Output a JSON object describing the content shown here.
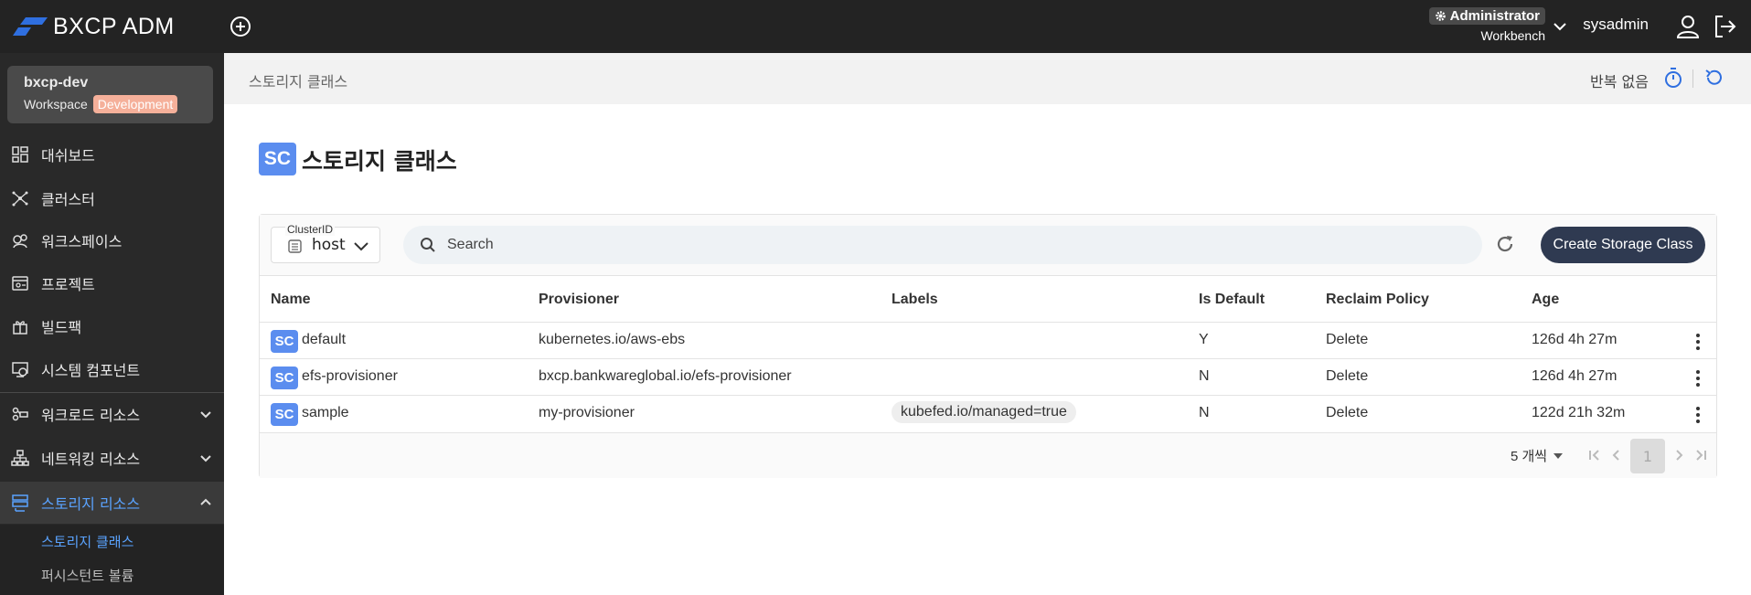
{
  "topbar": {
    "app_name": "BXCP ADMIN",
    "role": "Administrator",
    "role_sub": "Workbench",
    "username": "sysadmin"
  },
  "workspace": {
    "name": "bxcp-dev",
    "type": "Workspace",
    "badge": "Development"
  },
  "sidebar": {
    "items": [
      {
        "label": "대쉬보드",
        "icon": "dashboard-icon"
      },
      {
        "label": "클러스터",
        "icon": "cluster-icon"
      },
      {
        "label": "워크스페이스",
        "icon": "workspace-icon"
      },
      {
        "label": "프로젝트",
        "icon": "project-icon"
      },
      {
        "label": "빌드팩",
        "icon": "buildpack-icon"
      },
      {
        "label": "시스템 컴포넌트",
        "icon": "system-component-icon"
      },
      {
        "label": "워크로드 리소스",
        "icon": "workload-icon"
      },
      {
        "label": "네트워킹 리소스",
        "icon": "network-icon"
      },
      {
        "label": "스토리지 리소스",
        "icon": "storage-icon"
      }
    ],
    "sub_items": [
      "스토리지 클래스",
      "퍼시스턴트 볼륨"
    ]
  },
  "header": {
    "breadcrumb": "스토리지 클래스",
    "repeat": "반복 없음"
  },
  "page": {
    "badge": "SC",
    "title": "스토리지 클래스"
  },
  "toolbar": {
    "cluster_label": "ClusterID",
    "cluster_value": "host",
    "search_placeholder": "Search",
    "create_label": "Create Storage Class"
  },
  "table": {
    "headers": [
      "Name",
      "Provisioner",
      "Labels",
      "Is Default",
      "Reclaim Policy",
      "Age"
    ],
    "badge": "SC",
    "rows": [
      {
        "name": "default",
        "provisioner": "kubernetes.io/aws-ebs",
        "label": "",
        "is_default": "Y",
        "reclaim": "Delete",
        "age": "126d 4h 27m"
      },
      {
        "name": "efs-provisioner",
        "provisioner": "bxcp.bankwareglobal.io/efs-provisioner",
        "label": "",
        "is_default": "N",
        "reclaim": "Delete",
        "age": "126d 4h 27m"
      },
      {
        "name": "sample",
        "provisioner": "my-provisioner",
        "label": "kubefed.io/managed=true",
        "is_default": "N",
        "reclaim": "Delete",
        "age": "122d 21h 32m"
      }
    ]
  },
  "pagination": {
    "per_page": "5 개씩",
    "current_page": "1"
  },
  "colors": {
    "accent": "#5aa3ff",
    "badge": "#5b8def",
    "button": "#2f3a51",
    "dev_badge": "#f5b09a"
  }
}
